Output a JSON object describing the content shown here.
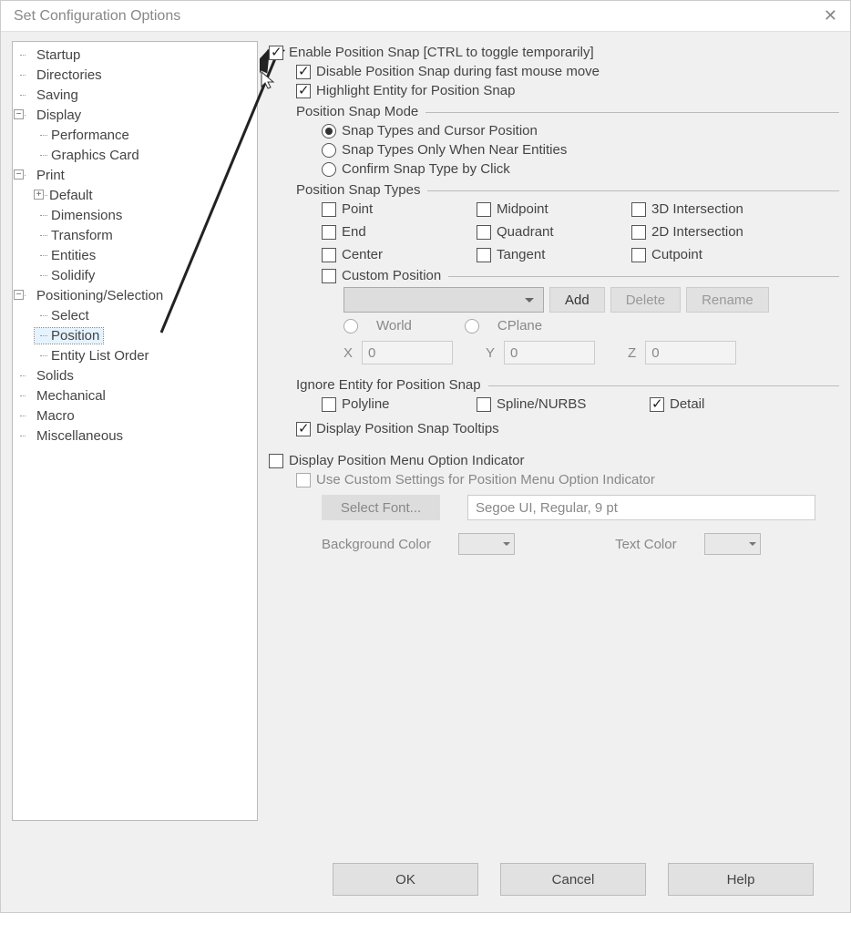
{
  "window": {
    "title": "Set Configuration Options"
  },
  "tree": [
    {
      "label": "Startup"
    },
    {
      "label": "Directories"
    },
    {
      "label": "Saving"
    },
    {
      "label": "Display",
      "expander": "-",
      "children": [
        {
          "label": "Performance"
        },
        {
          "label": "Graphics Card"
        }
      ]
    },
    {
      "label": "Print",
      "expander": "-",
      "children": [
        {
          "label": "Default",
          "expander": "+"
        },
        {
          "label": "Dimensions"
        },
        {
          "label": "Transform"
        },
        {
          "label": "Entities"
        },
        {
          "label": "Solidify"
        }
      ]
    },
    {
      "label": "Positioning/Selection",
      "expander": "-",
      "children": [
        {
          "label": "Select"
        },
        {
          "label": "Position",
          "selected": true
        },
        {
          "label": "Entity List Order"
        }
      ]
    },
    {
      "label": "Solids"
    },
    {
      "label": "Mechanical"
    },
    {
      "label": "Macro"
    },
    {
      "label": "Miscellaneous"
    }
  ],
  "main": {
    "enable_snap": "Enable Position Snap [CTRL to toggle temporarily]",
    "disable_fast": "Disable Position Snap during fast mouse move",
    "highlight": "Highlight Entity for Position Snap",
    "mode_header": "Position Snap Mode",
    "mode1": "Snap Types and Cursor Position",
    "mode2": "Snap Types Only When Near Entities",
    "mode3": "Confirm Snap Type by Click",
    "types_header": "Position Snap Types",
    "t_point": "Point",
    "t_midpoint": "Midpoint",
    "t_3dint": "3D Intersection",
    "t_end": "End",
    "t_quadrant": "Quadrant",
    "t_2dint": "2D Intersection",
    "t_center": "Center",
    "t_tangent": "Tangent",
    "t_cutpoint": "Cutpoint",
    "t_custom": "Custom Position",
    "btn_add": "Add",
    "btn_delete": "Delete",
    "btn_rename": "Rename",
    "world": "World",
    "cplane": "CPlane",
    "x": "X",
    "y": "Y",
    "z": "Z",
    "x_val": "0",
    "y_val": "0",
    "z_val": "0",
    "ignore_header": "Ignore Entity for Position Snap",
    "ig_polyline": "Polyline",
    "ig_spline": "Spline/NURBS",
    "ig_detail": "Detail",
    "tooltips": "Display Position Snap Tooltips",
    "menu_indicator": "Display Position Menu Option Indicator",
    "use_custom": "Use Custom Settings for Position Menu Option Indicator",
    "select_font": "Select Font...",
    "font_value": "Segoe UI, Regular, 9 pt",
    "bg_color": "Background Color",
    "text_color": "Text Color"
  },
  "buttons": {
    "ok": "OK",
    "cancel": "Cancel",
    "help": "Help"
  }
}
